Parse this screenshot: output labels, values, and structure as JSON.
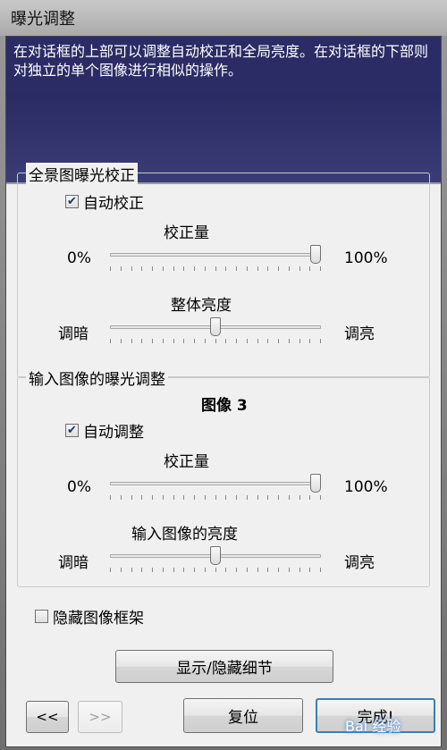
{
  "window": {
    "title": "曝光调整"
  },
  "description": "在对话框的上部可以调整自动校正和全局亮度。在对话框的下部则对独立的单个图像进行相似的操作。",
  "panorama_group": {
    "legend": "全景图曝光校正",
    "auto_checkbox": {
      "label": "自动校正",
      "checked": true
    },
    "correction_slider": {
      "title": "校正量",
      "min_label": "0%",
      "max_label": "100%",
      "value_percent": 100
    },
    "brightness_slider": {
      "title": "整体亮度",
      "min_label": "调暗",
      "max_label": "调亮",
      "value_percent": 50
    }
  },
  "input_group": {
    "legend": "输入图像的曝光调整",
    "image_label": "图像 3",
    "auto_checkbox": {
      "label": "自动调整",
      "checked": true
    },
    "correction_slider": {
      "title": "校正量",
      "min_label": "0%",
      "max_label": "100%",
      "value_percent": 100
    },
    "brightness_slider": {
      "title": "输入图像的亮度",
      "min_label": "调暗",
      "max_label": "调亮",
      "value_percent": 50
    }
  },
  "hide_frame_checkbox": {
    "label": "隐藏图像框架",
    "checked": false
  },
  "buttons": {
    "toggle_details": "显示/隐藏细节",
    "prev": "<<",
    "next": ">>",
    "reset": "复位",
    "done": "完成!"
  },
  "watermark": "Bai 经验"
}
